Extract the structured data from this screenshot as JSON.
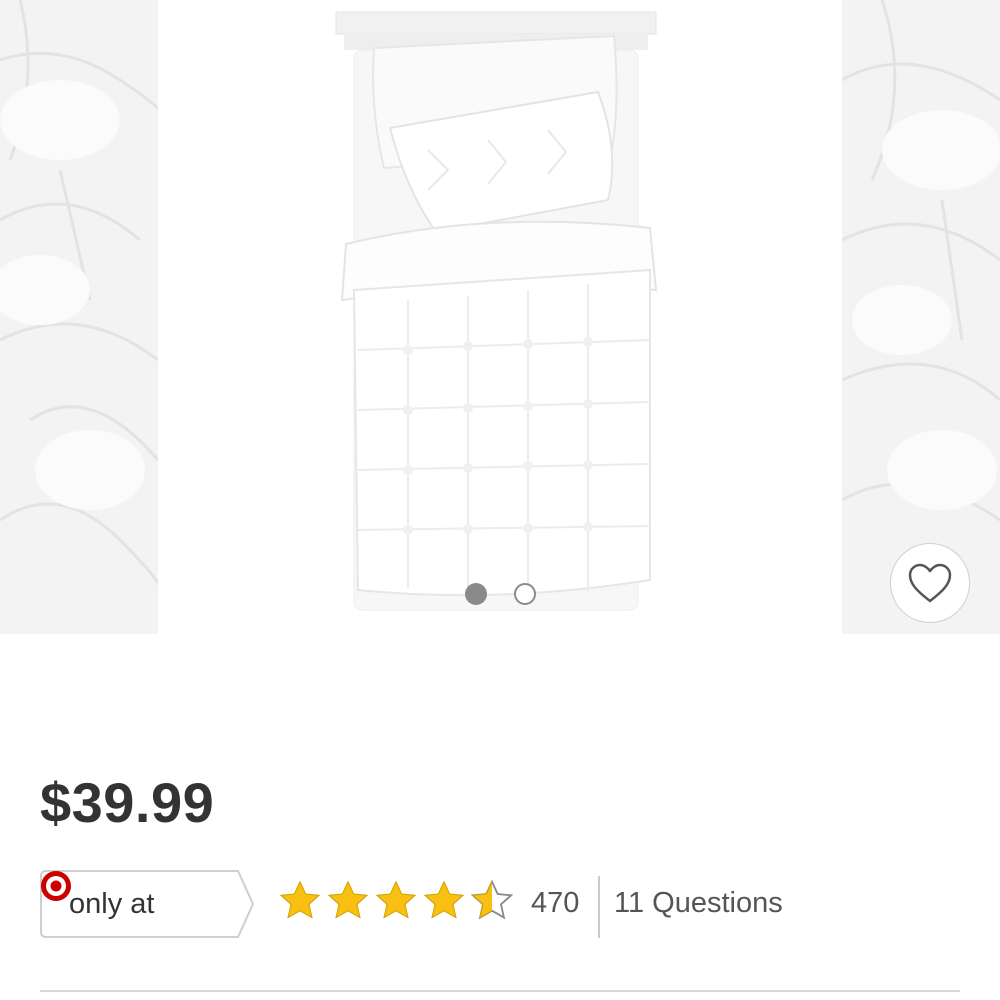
{
  "product": {
    "price": "$39.99",
    "availability_label": "only at",
    "retailer_logo": "target-bullseye-icon",
    "rating": 4.5,
    "rating_max": 5,
    "review_count": "470",
    "questions_label": "11 Questions"
  },
  "carousel": {
    "image_count": 2,
    "active_index": 0,
    "favorite_icon": "heart-outline-icon"
  },
  "colors": {
    "brand_red": "#cc0000",
    "star_gold": "#f8c012",
    "price_text": "#333333",
    "dot_active": "#8a8a8a"
  }
}
